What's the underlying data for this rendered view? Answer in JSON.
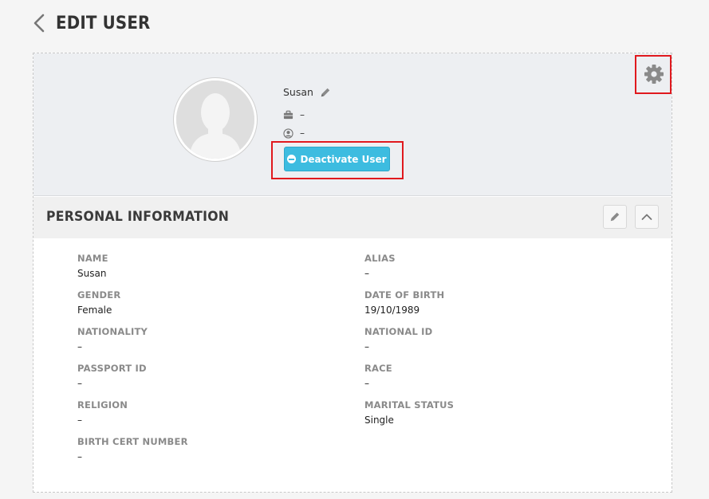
{
  "header": {
    "title": "EDIT USER",
    "back_icon": "chevron-left-icon"
  },
  "profile": {
    "name": "Susan",
    "job": "–",
    "user": "–",
    "deactivate_label": "Deactivate User",
    "button_color": "#3dbce0"
  },
  "section": {
    "title": "PERSONAL INFORMATION"
  },
  "fields": [
    {
      "label": "NAME",
      "value": "Susan"
    },
    {
      "label": "ALIAS",
      "value": "–"
    },
    {
      "label": "GENDER",
      "value": "Female"
    },
    {
      "label": "DATE OF BIRTH",
      "value": "19/10/1989"
    },
    {
      "label": "NATIONALITY",
      "value": "–"
    },
    {
      "label": "NATIONAL ID",
      "value": "–"
    },
    {
      "label": "PASSPORT ID",
      "value": "–"
    },
    {
      "label": "RACE",
      "value": "–"
    },
    {
      "label": "RELIGION",
      "value": "–"
    },
    {
      "label": "MARITAL STATUS",
      "value": "Single"
    },
    {
      "label": "BIRTH CERT NUMBER",
      "value": "–"
    }
  ],
  "highlight_color": "#e0191e"
}
